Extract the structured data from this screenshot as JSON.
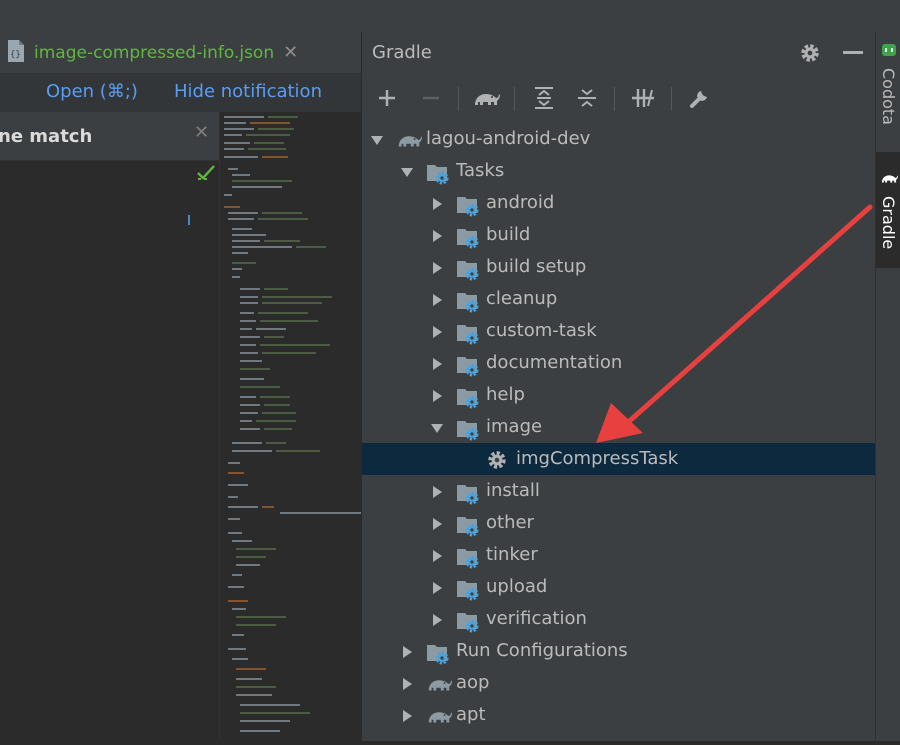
{
  "editor": {
    "tab_title": "image-compressed-info.json",
    "notification": {
      "open_label": "Open (⌘;)",
      "hide_label": "Hide notification"
    },
    "find_bar_text": "ne match"
  },
  "gradle": {
    "title": "Gradle",
    "toolbar": [
      "add-icon",
      "remove-icon",
      "elephant-icon",
      "expand-all-icon",
      "collapse-all-icon",
      "toggle-offline-icon",
      "wrench-icon"
    ],
    "tree": [
      {
        "label": "lagou-android-dev",
        "icon": "elephant-icon",
        "expanded": true,
        "depth": 0
      },
      {
        "label": "Tasks",
        "icon": "folder-gear-icon",
        "expanded": true,
        "depth": 1
      },
      {
        "label": "android",
        "icon": "folder-gear-icon",
        "expanded": false,
        "depth": 2
      },
      {
        "label": "build",
        "icon": "folder-gear-icon",
        "expanded": false,
        "depth": 2
      },
      {
        "label": "build setup",
        "icon": "folder-gear-icon",
        "expanded": false,
        "depth": 2
      },
      {
        "label": "cleanup",
        "icon": "folder-gear-icon",
        "expanded": false,
        "depth": 2
      },
      {
        "label": "custom-task",
        "icon": "folder-gear-icon",
        "expanded": false,
        "depth": 2
      },
      {
        "label": "documentation",
        "icon": "folder-gear-icon",
        "expanded": false,
        "depth": 2
      },
      {
        "label": "help",
        "icon": "folder-gear-icon",
        "expanded": false,
        "depth": 2
      },
      {
        "label": "image",
        "icon": "folder-gear-icon",
        "expanded": true,
        "depth": 2
      },
      {
        "label": "imgCompressTask",
        "icon": "gear-icon",
        "selected": true,
        "depth": 3
      },
      {
        "label": "install",
        "icon": "folder-gear-icon",
        "expanded": false,
        "depth": 2
      },
      {
        "label": "other",
        "icon": "folder-gear-icon",
        "expanded": false,
        "depth": 2
      },
      {
        "label": "tinker",
        "icon": "folder-gear-icon",
        "expanded": false,
        "depth": 2
      },
      {
        "label": "upload",
        "icon": "folder-gear-icon",
        "expanded": false,
        "depth": 2
      },
      {
        "label": "verification",
        "icon": "folder-gear-icon",
        "expanded": false,
        "depth": 2
      },
      {
        "label": "Run Configurations",
        "icon": "folder-gear-icon",
        "expanded": false,
        "depth": 1
      },
      {
        "label": "aop",
        "icon": "elephant-icon",
        "expanded": false,
        "depth": 1
      },
      {
        "label": "apt",
        "icon": "elephant-icon",
        "expanded": false,
        "depth": 1
      }
    ]
  },
  "side_tabs": {
    "codota": "Codota",
    "gradle": "Gradle"
  },
  "colors": {
    "selection": "#0d293e",
    "link": "#589df6",
    "tab_text": "#62b543",
    "annotation_arrow": "#e8403f",
    "gear_blue": "#4ba1d8"
  }
}
